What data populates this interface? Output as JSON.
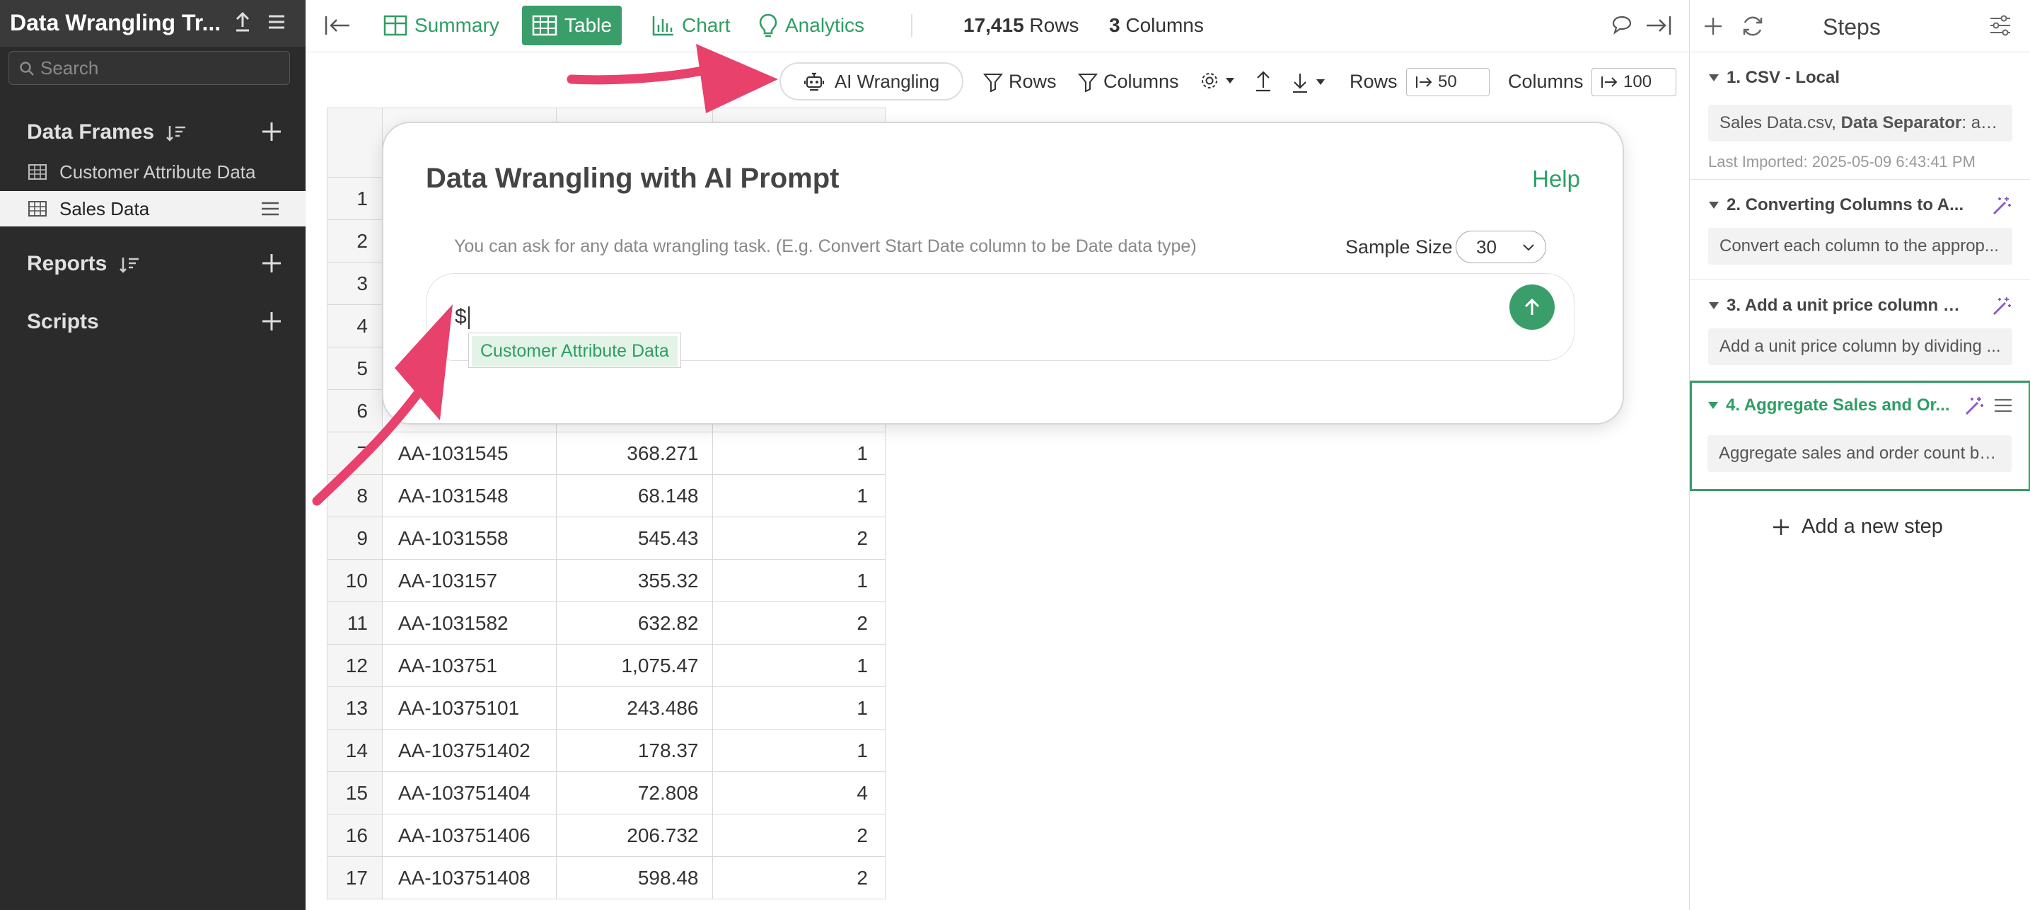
{
  "sidebar": {
    "title": "Data Wrangling Tr...",
    "search_placeholder": "Search",
    "data_frames_label": "Data Frames",
    "data_frames": [
      {
        "name": "Customer Attribute Data"
      },
      {
        "name": "Sales Data"
      }
    ],
    "reports_label": "Reports",
    "scripts_label": "Scripts"
  },
  "toolbar": {
    "tabs": [
      {
        "label": "Summary"
      },
      {
        "label": "Table"
      },
      {
        "label": "Chart"
      },
      {
        "label": "Analytics"
      }
    ],
    "rows_count": "17,415",
    "rows_label": "Rows",
    "cols_count": "3",
    "cols_label": "Columns"
  },
  "subbar": {
    "ai_label": "AI Wrangling",
    "rows_filter": "Rows",
    "columns_filter": "Columns",
    "rows_label": "Rows",
    "rows_value": "50",
    "columns_label": "Columns",
    "columns_value": "100"
  },
  "table": {
    "rows": [
      {
        "n": "1",
        "id": "",
        "sales": "",
        "count": ""
      },
      {
        "n": "2",
        "id": "",
        "sales": "",
        "count": ""
      },
      {
        "n": "3",
        "id": "",
        "sales": "",
        "count": ""
      },
      {
        "n": "4",
        "id": "",
        "sales": "",
        "count": ""
      },
      {
        "n": "5",
        "id": "",
        "sales": "",
        "count": ""
      },
      {
        "n": "6",
        "id": "",
        "sales": "",
        "count": ""
      },
      {
        "n": "7",
        "id": "AA-1031545",
        "sales": "368.271",
        "count": "1"
      },
      {
        "n": "8",
        "id": "AA-1031548",
        "sales": "68.148",
        "count": "1"
      },
      {
        "n": "9",
        "id": "AA-1031558",
        "sales": "545.43",
        "count": "2"
      },
      {
        "n": "10",
        "id": "AA-103157",
        "sales": "355.32",
        "count": "1"
      },
      {
        "n": "11",
        "id": "AA-1031582",
        "sales": "632.82",
        "count": "2"
      },
      {
        "n": "12",
        "id": "AA-103751",
        "sales": "1,075.47",
        "count": "1"
      },
      {
        "n": "13",
        "id": "AA-10375101",
        "sales": "243.486",
        "count": "1"
      },
      {
        "n": "14",
        "id": "AA-103751402",
        "sales": "178.37",
        "count": "1"
      },
      {
        "n": "15",
        "id": "AA-103751404",
        "sales": "72.808",
        "count": "4"
      },
      {
        "n": "16",
        "id": "AA-103751406",
        "sales": "206.732",
        "count": "2"
      },
      {
        "n": "17",
        "id": "AA-103751408",
        "sales": "598.48",
        "count": "2"
      }
    ]
  },
  "modal": {
    "title": "Data Wrangling with AI Prompt",
    "help": "Help",
    "hint": "You can ask for any data wrangling task. (E.g. Convert Start Date column to be Date data type)",
    "sample_size_label": "Sample Size",
    "sample_size_value": "30",
    "prompt_value": "$",
    "suggestion": "Customer Attribute Data"
  },
  "steps": {
    "title": "Steps",
    "items": [
      {
        "title": "1. CSV - Local",
        "desc_prefix": "Sales Data.csv, ",
        "desc_bold": "Data Separator",
        "desc_suffix": ": auto",
        "meta": "Last Imported: 2025-05-09 6:43:41 PM"
      },
      {
        "title": "2. Converting Columns to A...",
        "desc": "Convert each column to the approp..."
      },
      {
        "title": "3. Add a unit price column b...",
        "desc": "Add a unit price column by dividing ..."
      },
      {
        "title": "4. Aggregate Sales and Or...",
        "desc": "Aggregate sales and order count by..."
      }
    ],
    "add_label": "Add a new step"
  },
  "colors": {
    "accent": "#3a9e6a",
    "accent_text": "#2e9e63",
    "sidebar_bg": "#2b2b2b",
    "arrow": "#e8416c",
    "wand": "#8e5cc9"
  }
}
